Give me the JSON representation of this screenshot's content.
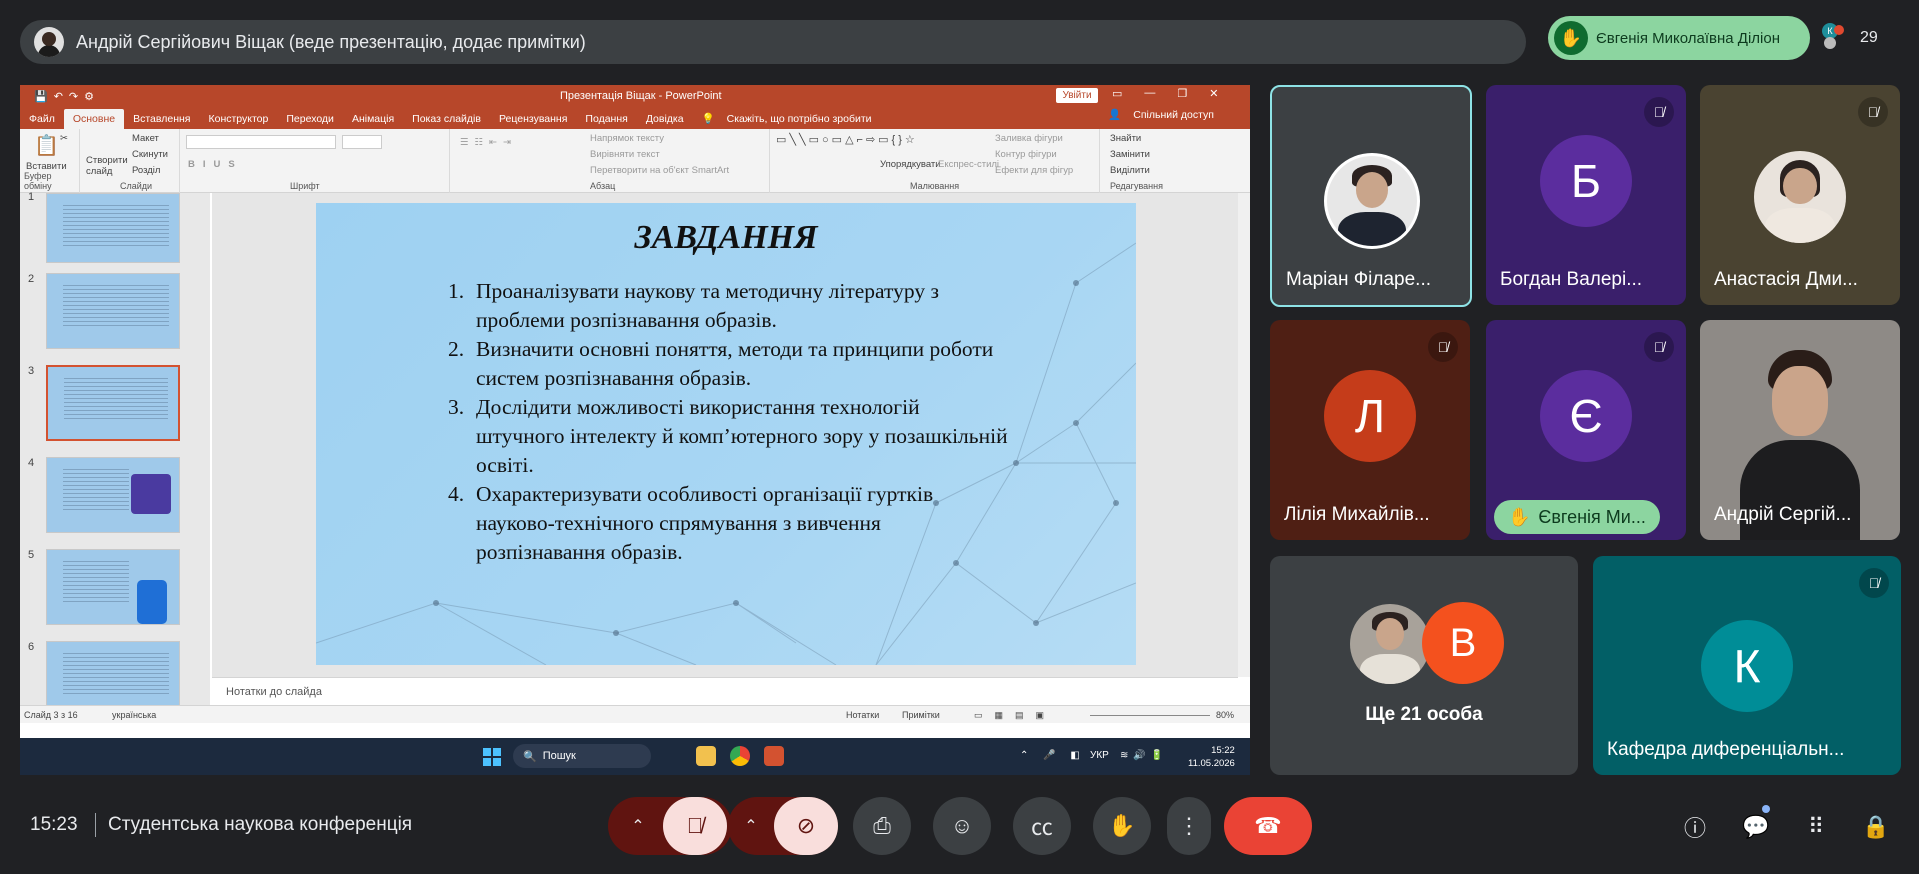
{
  "meet": {
    "presenter_label": "Андрій Сергійович Віщак (веде презентацію, додає примітки)",
    "raised_hand_name": "Євгенія Миколаївна Діліон",
    "participant_count": "29",
    "count_avatar_initial": "К",
    "time": "15:23",
    "meeting_title": "Студентська наукова конференція"
  },
  "ppt": {
    "window_title": "Презентація Віщак  -  PowerPoint",
    "signin": "Увійти",
    "menu": [
      "Файл",
      "Основне",
      "Вставлення",
      "Конструктор",
      "Переходи",
      "Анімація",
      "Показ слайдів",
      "Рецензування",
      "Подання",
      "Довідка",
      "Скажіть, що потрібно зробити"
    ],
    "share_label": "Спільний доступ",
    "ribbon": {
      "paste": "Вставити",
      "clipboard": "Буфер обміну",
      "layout": "Макет",
      "reset": "Скинути",
      "section": "Розділ",
      "new_slide": "Створити слайд",
      "slides": "Слайди",
      "font": "Шрифт",
      "paragraph": "Абзац",
      "text_direction": "Напрямок тексту",
      "align_text": "Вирівняти текст",
      "smartart": "Перетворити на об'єкт SmartArt",
      "drawing": "Малювання",
      "arrange": "Упорядкувати",
      "quick_styles": "Експрес-стилі",
      "shape_fill": "Заливка фігури",
      "shape_outline": "Контур фігури",
      "shape_effects": "Ефекти для фігур",
      "find": "Знайти",
      "replace": "Замінити",
      "select": "Виділити",
      "editing": "Редагування"
    },
    "slide_numbers": [
      "1",
      "2",
      "3",
      "4",
      "5",
      "6"
    ],
    "slide": {
      "title": "ЗАВДАННЯ",
      "items": [
        {
          "n": "1.",
          "text": "Проаналізувати наукову та методичну літературу з проблеми розпізнавання образів."
        },
        {
          "n": "2.",
          "text": "Визначити основні поняття, методи та принципи роботи систем розпізнавання образів."
        },
        {
          "n": "3.",
          "text": "Дослідити можливості використання технологій штучного інтелекту й комп’ютерного зору у позашкільній освіті."
        },
        {
          "n": "4.",
          "text": "Охарактеризувати особливості організації гуртків науково-технічного спрямування з вивчення розпізнавання образів."
        }
      ]
    },
    "notes_placeholder": "Нотатки до слайда",
    "status": {
      "slide_info": "Слайд 3 з 16",
      "language": "українська",
      "notes": "Нотатки",
      "comments": "Примітки",
      "zoom": "80%"
    }
  },
  "taskbar": {
    "search": "Пошук",
    "lang": "УКР",
    "clock_time": "15:22",
    "clock_date": "11.05.2026"
  },
  "tiles": [
    {
      "name": "Маріан Філаре..."
    },
    {
      "name": "Богдан Валері...",
      "initial": "Б"
    },
    {
      "name": "Анастасія Дми..."
    },
    {
      "name": "Лілія Михайлів...",
      "initial": "Л"
    },
    {
      "name": "Євгенія Ми...",
      "initial": "Є"
    },
    {
      "name": "Андрій Сергій..."
    },
    {
      "name": "Ще 21 особа",
      "initial": "В"
    },
    {
      "name": "Кафедра диференціальн...",
      "initial": "К"
    }
  ],
  "colors": {
    "ppt_accent": "#b7472a",
    "end_call": "#ea4335",
    "hand_pill": "#8cd5a0",
    "tile_b": "#5b2d9e",
    "tile_l": "#c53c1a",
    "tile_k": "#007b83"
  }
}
